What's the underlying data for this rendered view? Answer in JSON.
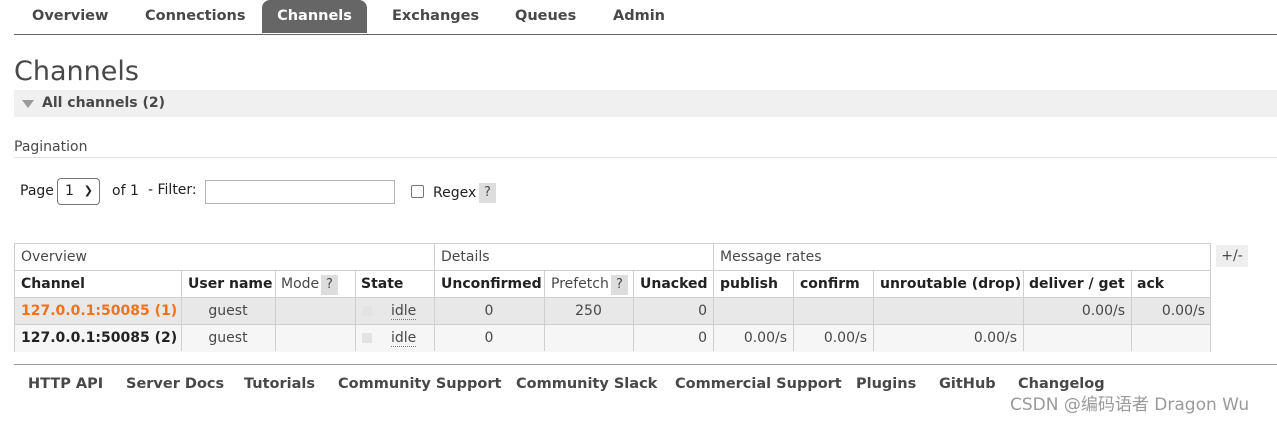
{
  "nav": {
    "tabs": [
      {
        "label": "Overview"
      },
      {
        "label": "Connections"
      },
      {
        "label": "Channels",
        "active": true
      },
      {
        "label": "Exchanges"
      },
      {
        "label": "Queues"
      },
      {
        "label": "Admin"
      }
    ]
  },
  "page": {
    "title": "Channels",
    "section_label": "All channels (2)"
  },
  "pagination": {
    "label": "Pagination",
    "page_label": "Page",
    "page_value": "1",
    "of_label": "of 1",
    "filter_label": "- Filter:",
    "filter_value": "",
    "regex_label": "Regex",
    "help": "?"
  },
  "table": {
    "groups": [
      "Overview",
      "Details",
      "Message rates"
    ],
    "columns": [
      "Channel",
      "User name",
      "Mode",
      "State",
      "Unconfirmed",
      "Prefetch",
      "Unacked",
      "publish",
      "confirm",
      "unroutable (drop)",
      "deliver / get",
      "ack"
    ],
    "help": "?",
    "toggle": "+/-",
    "rows": [
      {
        "channel": "127.0.0.1:50085 (1)",
        "user": "guest",
        "mode": "",
        "state": "idle",
        "unconfirmed": "0",
        "prefetch": "250",
        "unacked": "0",
        "publish": "",
        "confirm": "",
        "unroutable": "",
        "deliver": "0.00/s",
        "ack": "0.00/s"
      },
      {
        "channel": "127.0.0.1:50085 (2)",
        "user": "guest",
        "mode": "",
        "state": "idle",
        "unconfirmed": "0",
        "prefetch": "",
        "unacked": "0",
        "publish": "0.00/s",
        "confirm": "0.00/s",
        "unroutable": "0.00/s",
        "deliver": "",
        "ack": ""
      }
    ]
  },
  "footer": {
    "links": [
      "HTTP API",
      "Server Docs",
      "Tutorials",
      "Community Support",
      "Community Slack",
      "Commercial Support",
      "Plugins",
      "GitHub",
      "Changelog"
    ]
  },
  "watermark": "CSDN @编码语者 Dragon Wu",
  "colors": {
    "accent_orange": "#f2711c",
    "active_tab": "#666666"
  }
}
